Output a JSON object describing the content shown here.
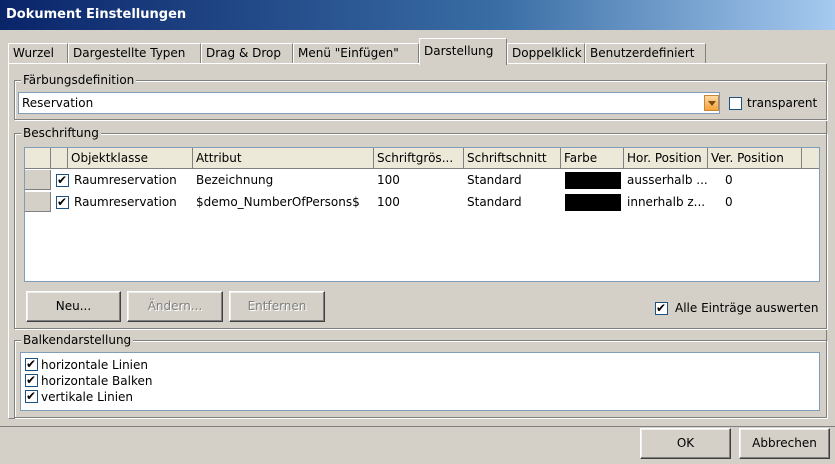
{
  "window": {
    "title": "Dokument Einstellungen"
  },
  "tabs": [
    {
      "label": "Wurzel"
    },
    {
      "label": "Dargestellte Typen"
    },
    {
      "label": "Drag & Drop"
    },
    {
      "label": "Menü \"Einfügen\""
    },
    {
      "label": "Darstellung",
      "active": true
    },
    {
      "label": "Doppelklick"
    },
    {
      "label": "Benutzerdefiniert"
    }
  ],
  "faerbung": {
    "legend": "Färbungsdefinition",
    "selected": "Reservation",
    "transparent_label": "transparent",
    "transparent_checked": false
  },
  "beschriftung": {
    "legend": "Beschriftung",
    "columns": [
      "Objektklasse",
      "Attribut",
      "Schriftgrös...",
      "Schriftschnitt",
      "Farbe",
      "Hor. Position",
      "Ver. Position"
    ],
    "rows": [
      {
        "checked": true,
        "objektklasse": "Raumreservation",
        "attribut": "Bezeichnung",
        "groesse": "100",
        "schnitt": "Standard",
        "farbe": "#000000",
        "hor": "ausserhalb ...",
        "ver": "0"
      },
      {
        "checked": true,
        "objektklasse": "Raumreservation",
        "attribut": "$demo_NumberOfPersons$",
        "groesse": "100",
        "schnitt": "Standard",
        "farbe": "#000000",
        "hor": "innerhalb z...",
        "ver": "0"
      }
    ],
    "buttons": {
      "neu": "Neu...",
      "aendern": "Ändern...",
      "entfernen": "Entfernen"
    },
    "alle_label": "Alle Einträge auswerten",
    "alle_checked": true
  },
  "balken": {
    "legend": "Balkendarstellung",
    "items": [
      {
        "label": "horizontale Linien",
        "checked": true
      },
      {
        "label": "horizontale Balken",
        "checked": true
      },
      {
        "label": "vertikale Linien",
        "checked": true
      }
    ]
  },
  "footer": {
    "ok": "OK",
    "cancel": "Abbrechen"
  },
  "icons": {
    "dropdown": "chevron-down-icon",
    "check": "checkmark-icon"
  }
}
